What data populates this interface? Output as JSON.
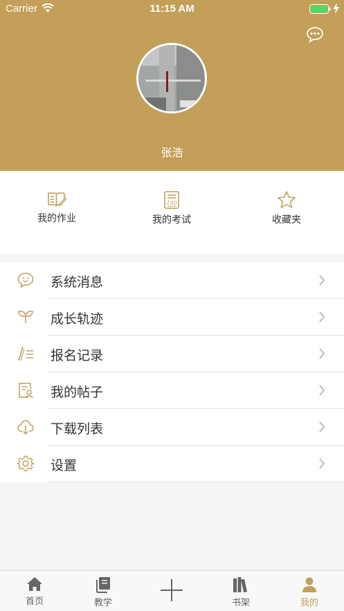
{
  "status_bar": {
    "carrier": "Carrier",
    "time": "11:15 AM"
  },
  "profile": {
    "name": "张浩"
  },
  "quick_actions": [
    {
      "label": "我的作业",
      "icon": "book-edit-icon"
    },
    {
      "label": "我的考试",
      "icon": "exam-paper-icon"
    },
    {
      "label": "收藏夹",
      "icon": "star-icon"
    }
  ],
  "menu": [
    {
      "label": "系统消息",
      "icon": "message-bubble-icon"
    },
    {
      "label": "成长轨迹",
      "icon": "sprout-icon"
    },
    {
      "label": "报名记录",
      "icon": "pen-list-icon"
    },
    {
      "label": "我的帖子",
      "icon": "post-user-icon"
    },
    {
      "label": "下载列表",
      "icon": "cloud-download-icon"
    },
    {
      "label": "设置",
      "icon": "gear-icon"
    }
  ],
  "tabs": [
    {
      "label": "首页",
      "icon": "home-icon"
    },
    {
      "label": "教学",
      "icon": "book-stack-icon"
    },
    {
      "label": "书架",
      "icon": "bookshelf-icon"
    },
    {
      "label": "我的",
      "icon": "user-icon"
    }
  ],
  "colors": {
    "accent": "#c39f59",
    "background": "#f5f5f5"
  }
}
